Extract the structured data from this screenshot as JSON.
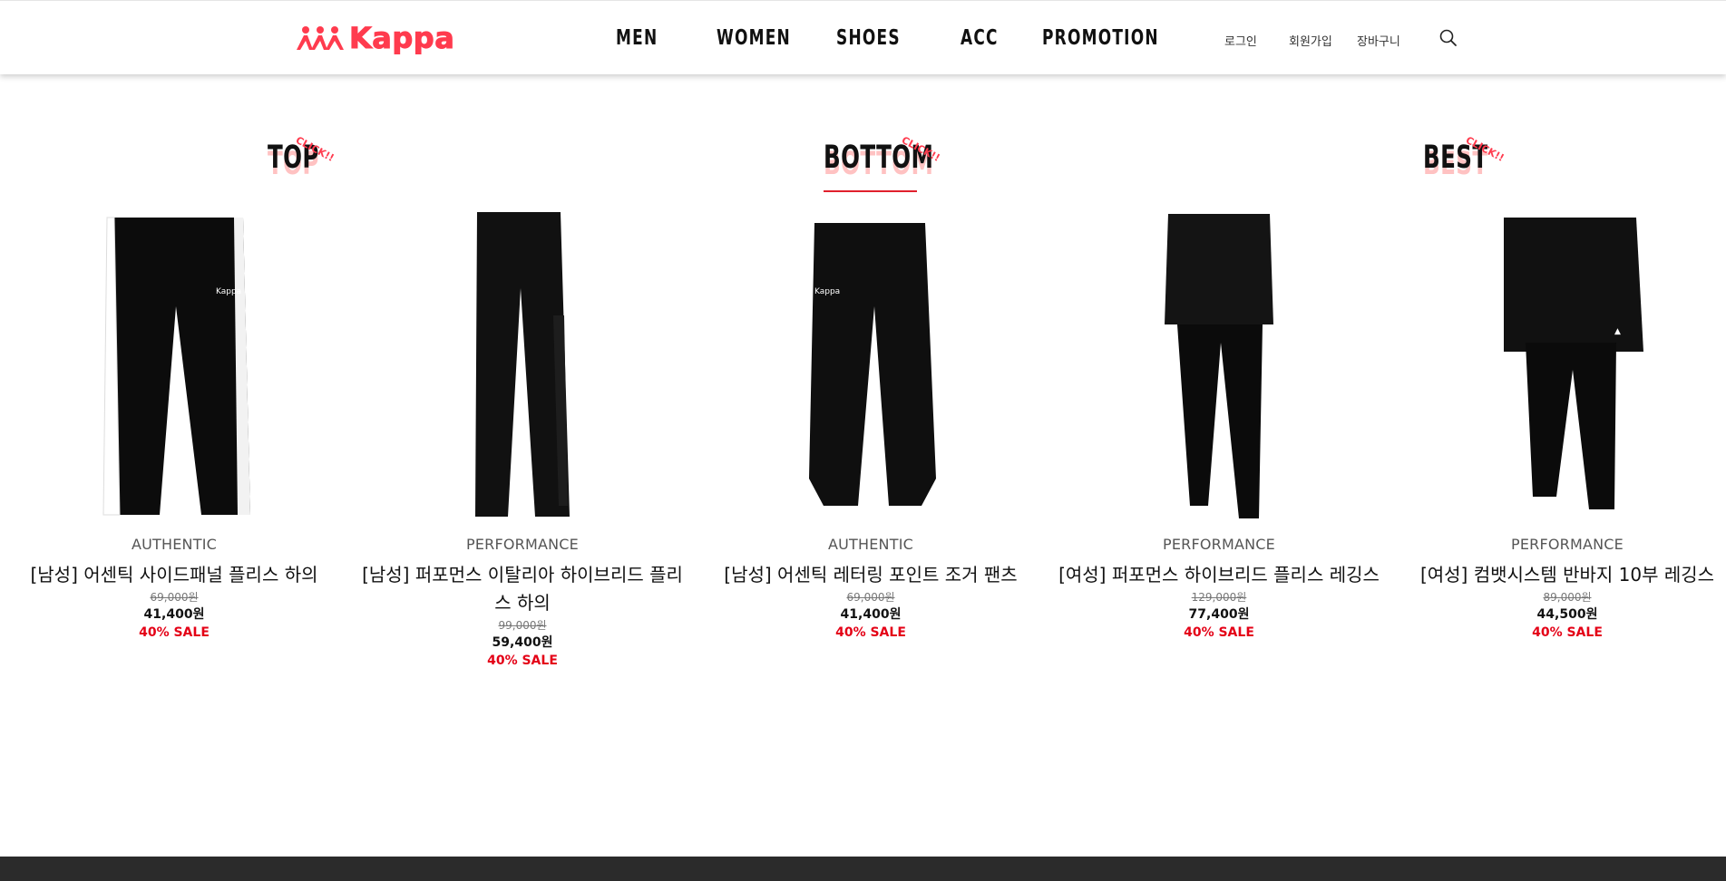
{
  "header": {
    "brand": "Kappa",
    "nav": [
      "MEN",
      "WOMEN",
      "SHOES",
      "ACC",
      "PROMOTION"
    ],
    "util": {
      "login": "로그인",
      "signup": "회원가입",
      "cart": "장바구니"
    },
    "accent_color": "#ff3b4e"
  },
  "categories": [
    {
      "title": "TOP",
      "tag": "CLICK!!"
    },
    {
      "title": "BOTTOM",
      "tag": "CLICK!!"
    },
    {
      "title": "BEST",
      "tag": "CLICK!!"
    }
  ],
  "products": [
    {
      "line": "AUTHENTIC",
      "name": "[남성] 어센틱 사이드패널 플리스 하의",
      "original_price": "69,000원",
      "price": "41,400원",
      "sale": "40% SALE"
    },
    {
      "line": "PERFORMANCE",
      "name": "[남성] 퍼포먼스 이탈리아 하이브리드 플리스 하의",
      "original_price": "99,000원",
      "price": "59,400원",
      "sale": "40% SALE"
    },
    {
      "line": "AUTHENTIC",
      "name": "[남성] 어센틱 레터링 포인트 조거 팬츠",
      "original_price": "69,000원",
      "price": "41,400원",
      "sale": "40% SALE"
    },
    {
      "line": "PERFORMANCE",
      "name": "[여성] 퍼포먼스 하이브리드 플리스 레깅스",
      "original_price": "129,000원",
      "price": "77,400원",
      "sale": "40% SALE"
    },
    {
      "line": "PERFORMANCE",
      "name": "[여성] 컴뱃시스템 반바지 10부 레깅스",
      "original_price": "89,000원",
      "price": "44,500원",
      "sale": "40% SALE"
    }
  ]
}
